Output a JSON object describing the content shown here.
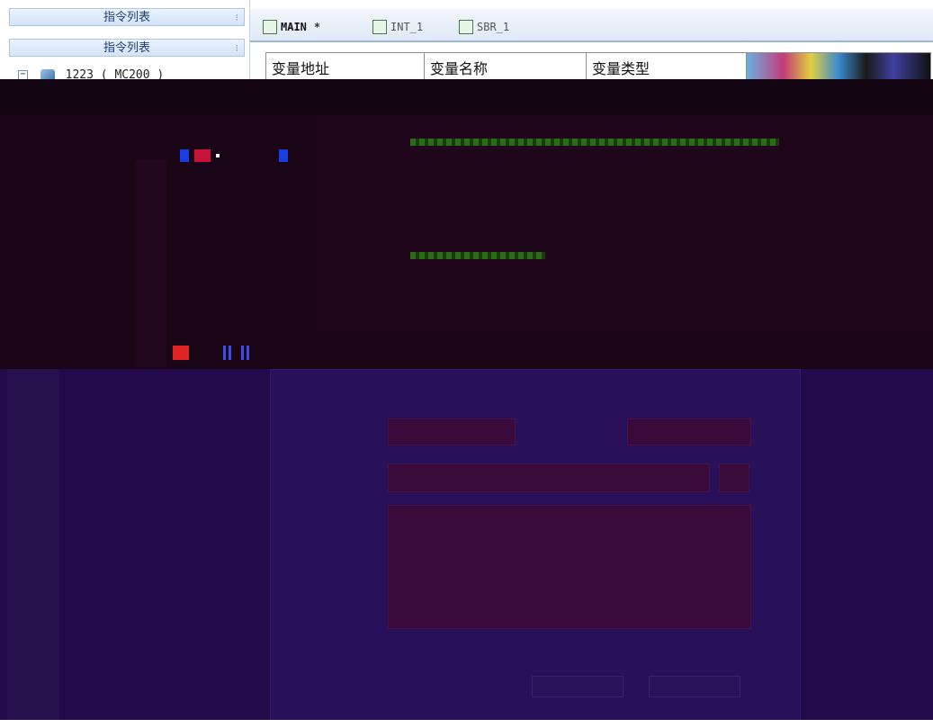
{
  "left_panel": {
    "header1": "指令列表",
    "header2": "指令列表",
    "tree_root": "1223 ( MC200 )"
  },
  "tabs": [
    {
      "label": "MAIN",
      "modified": "*",
      "active": true
    },
    {
      "label": "INT_1",
      "active": false
    },
    {
      "label": "SBR_1",
      "active": false
    }
  ],
  "table": {
    "columns": [
      "变量地址",
      "变量名称",
      "变量类型"
    ]
  },
  "colors": {
    "panel_header_text": "#1f3e74",
    "dark_band": "#1b0618",
    "purple_region": "#230a4a",
    "tab_border": "#9cb6da"
  },
  "icons": {
    "pin": "pin-icon",
    "expander": "expand-toggle-icon",
    "plc_node": "plc-device-icon",
    "ladder_tab": "ladder-diagram-icon"
  }
}
